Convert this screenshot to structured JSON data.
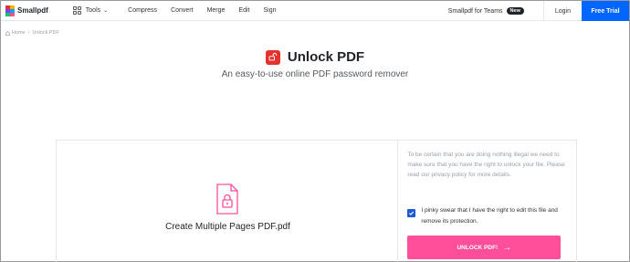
{
  "brand": {
    "name": "Smallpdf"
  },
  "nav": {
    "tools_label": "Tools",
    "links": [
      "Compress",
      "Convert",
      "Merge",
      "Edit",
      "Sign"
    ]
  },
  "header_right": {
    "teams_label": "Smallpdf for Teams",
    "badge": "New",
    "login": "Login",
    "trial": "Free Trial"
  },
  "breadcrumb": {
    "home": "Home",
    "current": "Unlock PDF"
  },
  "hero": {
    "title": "Unlock PDF",
    "subtitle": "An easy-to-use online PDF password remover"
  },
  "file": {
    "name": "Create Multiple Pages PDF.pdf"
  },
  "side": {
    "info": "To be certain that you are doing nothing illegal we need to make sure that you have the right to unlock your file. Please read our privacy policy for more details.",
    "checkbox_label": "I pinky swear that I have the right to edit this file and remove its protection.",
    "checkbox_checked": true,
    "button_label": "UNLOCK PDF!"
  },
  "colors": {
    "accent_blue": "#0066ff",
    "unlock_pink": "#ff4e9a",
    "hero_icon": "#e5322d",
    "file_icon": "#ff4e9a"
  }
}
